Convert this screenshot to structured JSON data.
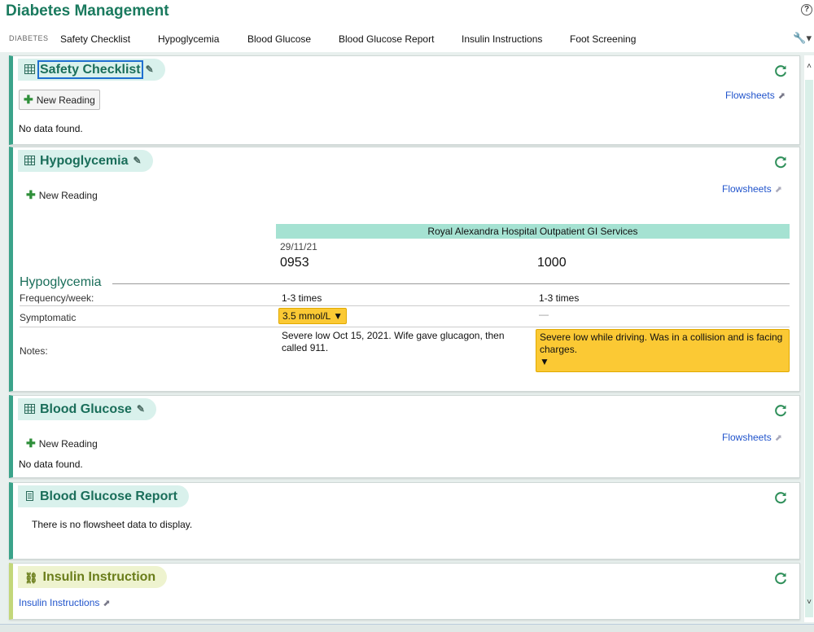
{
  "header": {
    "title": "Diabetes Management",
    "help_icon": "help-icon"
  },
  "tabs": {
    "section_label": "Diabetes",
    "items": [
      "Safety Checklist",
      "Hypoglycemia",
      "Blood Glucose",
      "Blood Glucose Report",
      "Insulin Instructions",
      "Foot Screening"
    ]
  },
  "panels": {
    "safety": {
      "title": "Safety Checklist",
      "new_reading": "New Reading",
      "flowsheets": "Flowsheets",
      "empty": "No data found."
    },
    "hypo": {
      "title": "Hypoglycemia",
      "new_reading": "New Reading",
      "flowsheets": "Flowsheets",
      "facility": "Royal Alexandra Hospital Outpatient GI Services",
      "date": "29/11/21",
      "times": [
        "0953",
        "1000"
      ],
      "section": "Hypoglycemia",
      "rows": [
        {
          "label": "Frequency/week:",
          "values": [
            "1-3 times",
            "1-3 times"
          ]
        },
        {
          "label": "Symptomatic",
          "values": [
            "3.5 mmol/L",
            "—"
          ]
        },
        {
          "label": "Notes:",
          "values": [
            "Severe low Oct 15, 2021. Wife gave glucagon, then called 911.",
            "Severe low while driving. Was in a collision and is facing charges."
          ]
        }
      ]
    },
    "glucose": {
      "title": "Blood Glucose",
      "new_reading": "New Reading",
      "flowsheets": "Flowsheets",
      "empty": "No data found."
    },
    "report": {
      "title": "Blood Glucose Report",
      "empty": "There is no flowsheet data to display."
    },
    "insulin": {
      "title": "Insulin Instruction",
      "link": "Insulin Instructions"
    }
  },
  "colors": {
    "accent": "#1a7a5e",
    "flag": "#fbc934",
    "link": "#2255cc"
  }
}
